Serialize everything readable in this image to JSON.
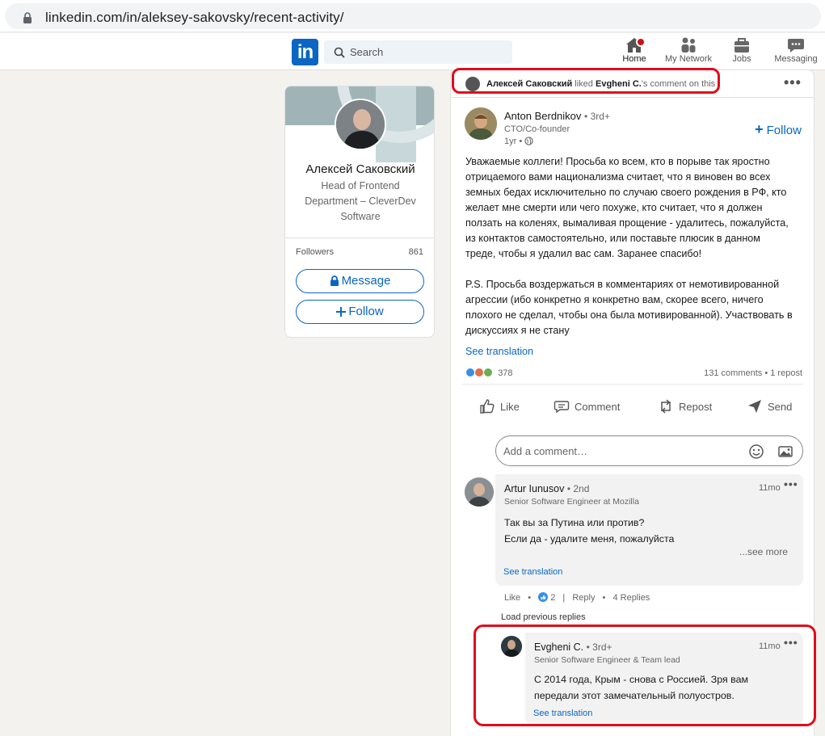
{
  "browser": {
    "url": "linkedin.com/in/aleksey-sakovsky/recent-activity/"
  },
  "nav": {
    "logo": "in",
    "search_placeholder": "Search",
    "items": [
      {
        "label": "Home"
      },
      {
        "label": "My Network"
      },
      {
        "label": "Jobs"
      },
      {
        "label": "Messaging"
      }
    ]
  },
  "profile": {
    "name": "Алексей Саковский",
    "headline": "Head of Frontend Department – CleverDev Software",
    "followers_label": "Followers",
    "followers_count": "861",
    "message_label": "Message",
    "follow_label": "Follow"
  },
  "activity": {
    "actor": "Алексей Саковский",
    "verb": "liked",
    "target": "Evgheni C.",
    "suffix": "'s comment on this"
  },
  "post": {
    "author": "Anton Berdnikov",
    "degree": "3rd+",
    "role": "CTO/Co-founder",
    "time": "1yr •",
    "follow_label": "Follow",
    "text": "Уважаемые коллеги! Просьба ко всем, кто в порыве так яростно\nотрицаемого вами национализма считает, что я виновен во всех\nземных бедах исключительно по случаю своего рождения в РФ, кто\nжелает мне смерти или чего похуже, кто считает, что я должен\nползать на коленях, вымаливая прощение - удалитесь, пожалуйста,\nиз контактов самостоятельно, или поставьте плюсик в данном\nтреде, чтобы я удалил вас сам. Заранее спасибо!\n\nP.S. Просьба воздержаться в комментариях от немотивированной\nагрессии (ибо конкретно я конкретно вам, скорее всего, ничего\nплохого не сделал, чтобы она была мотивированной). Участвовать в\nдискуссиях я не стану",
    "see_translation": "See translation",
    "reactions_count": "378",
    "comments_stat": "131 comments • 1 repost",
    "actions": [
      {
        "label": "Like"
      },
      {
        "label": "Comment"
      },
      {
        "label": "Repost"
      },
      {
        "label": "Send"
      }
    ],
    "comment_placeholder": "Add a comment…"
  },
  "comments": [
    {
      "name": "Artur Iunusov",
      "degree": "• 2nd",
      "role": "Senior Software Engineer at Mozilla",
      "time": "11mo",
      "text": "Так вы за Путина или против?\nЕсли да - удалите меня, пожалуйста",
      "see_more": "...see more",
      "see_translation": "See translation",
      "like_label": "Like",
      "like_count": "2",
      "reply_label": "Reply",
      "replies": "4 Replies"
    }
  ],
  "load_previous": "Load previous replies",
  "reply": {
    "name": "Evgheni C.",
    "degree": "• 3rd+",
    "role": "Senior Software Engineer & Team lead",
    "time": "11mo",
    "text": "С 2014 года, Крым - снова с Россией. Зря вам\nпередали этот замечательный полуостров.",
    "see_translation": "See translation"
  },
  "colors": {
    "brand": "#0a66c2",
    "highlight": "#e10c1a",
    "notification": "#cc1016"
  }
}
